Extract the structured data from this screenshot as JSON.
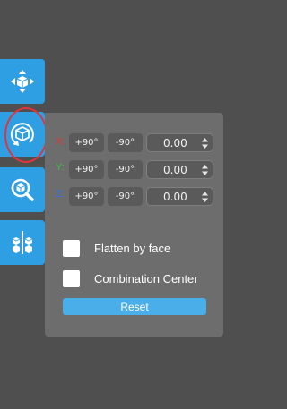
{
  "toolbar": {
    "tools": [
      {
        "name": "move-tool",
        "icon": "move-arrows-cube-icon"
      },
      {
        "name": "rotate-tool",
        "icon": "rotate-cube-icon",
        "active": true
      },
      {
        "name": "scale-tool",
        "icon": "scale-magnifier-cube-icon"
      },
      {
        "name": "mirror-tool",
        "icon": "mirror-cubes-icon"
      }
    ],
    "accent_color": "#2f9fe4",
    "highlight_color": "#e0353b"
  },
  "rotate_panel": {
    "rows": [
      {
        "axis": "X:",
        "color": "#e3342f",
        "plus_label": "+90°",
        "minus_label": "-90°",
        "value": "0.00"
      },
      {
        "axis": "Y:",
        "color": "#38c24a",
        "plus_label": "+90°",
        "minus_label": "-90°",
        "value": "0.00"
      },
      {
        "axis": "Z:",
        "color": "#2f6fe8",
        "plus_label": "+90°",
        "minus_label": "-90°",
        "value": "0.00"
      }
    ],
    "flatten_label": "Flatten by face",
    "flatten_checked": false,
    "combination_label": "Combination Center",
    "combination_checked": false,
    "reset_label": "Reset"
  }
}
